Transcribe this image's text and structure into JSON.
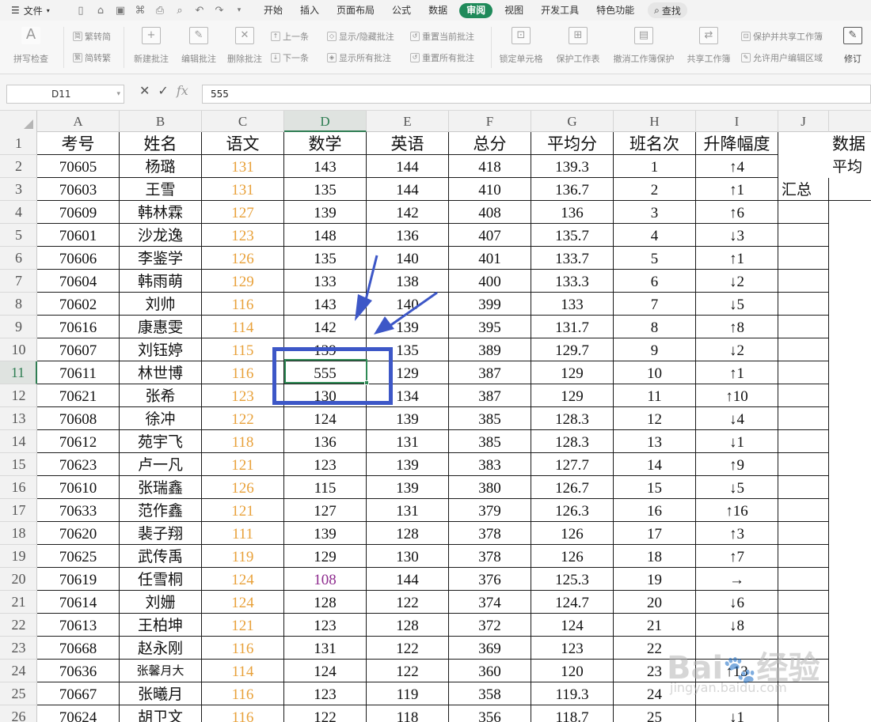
{
  "menubar": {
    "file_label": "文件",
    "tabs": [
      "开始",
      "插入",
      "页面布局",
      "公式",
      "数据",
      "审阅",
      "视图",
      "开发工具",
      "特色功能"
    ],
    "active_tab": "审阅",
    "search_label": "查找"
  },
  "ribbon": {
    "spell_check": "拼写检查",
    "trad_to_simp": "繁转简",
    "simp_to_trad": "简转繁",
    "new_comment": "新建批注",
    "edit_comment": "编辑批注",
    "delete_comment": "删除批注",
    "prev_item": "上一条",
    "next_item": "下一条",
    "show_hide_comment": "显示/隐藏批注",
    "show_all_comments": "显示所有批注",
    "reset_current_comment": "重置当前批注",
    "reset_all_comments": "重置所有批注",
    "lock_cell": "锁定单元格",
    "protect_sheet": "保护工作表",
    "unprotect_workbook": "撤消工作簿保护",
    "share_workbook": "共享工作簿",
    "protect_share_workbook": "保护并共享工作簿",
    "allow_edit_ranges": "允许用户编辑区域",
    "track_changes": "修订"
  },
  "formula_bar": {
    "name_box": "D11",
    "formula": "555"
  },
  "sheet": {
    "column_headers": [
      "A",
      "B",
      "C",
      "D",
      "E",
      "F",
      "G",
      "H",
      "I",
      "J"
    ],
    "selected_column": "D",
    "selected_row": 11,
    "row_numbers": [
      1,
      2,
      3,
      4,
      5,
      6,
      7,
      8,
      9,
      10,
      11,
      12,
      13,
      14,
      15,
      16,
      17,
      18,
      19,
      20,
      21,
      22,
      23,
      24,
      25,
      26
    ],
    "header_row": [
      "考号",
      "姓名",
      "语文",
      "数学",
      "英语",
      "总分",
      "平均分",
      "班名次",
      "升降幅度"
    ],
    "rows": [
      [
        "70605",
        "杨璐",
        "131",
        "143",
        "144",
        "418",
        "139.3",
        "1",
        "↑4"
      ],
      [
        "70603",
        "王雪",
        "131",
        "135",
        "144",
        "410",
        "136.7",
        "2",
        "↑1"
      ],
      [
        "70609",
        "韩林霖",
        "127",
        "139",
        "142",
        "408",
        "136",
        "3",
        "↑6"
      ],
      [
        "70601",
        "沙龙逸",
        "123",
        "148",
        "136",
        "407",
        "135.7",
        "4",
        "↓3"
      ],
      [
        "70606",
        "李鉴学",
        "126",
        "135",
        "140",
        "401",
        "133.7",
        "5",
        "↑1"
      ],
      [
        "70604",
        "韩雨萌",
        "129",
        "133",
        "138",
        "400",
        "133.3",
        "6",
        "↓2"
      ],
      [
        "70602",
        "刘帅",
        "116",
        "143",
        "140",
        "399",
        "133",
        "7",
        "↓5"
      ],
      [
        "70616",
        "康惠雯",
        "114",
        "142",
        "139",
        "395",
        "131.7",
        "8",
        "↑8"
      ],
      [
        "70607",
        "刘钰婷",
        "115",
        "139",
        "135",
        "389",
        "129.7",
        "9",
        "↓2"
      ],
      [
        "70611",
        "林世博",
        "116",
        "555",
        "129",
        "387",
        "129",
        "10",
        "↑1"
      ],
      [
        "70621",
        "张希",
        "123",
        "130",
        "134",
        "387",
        "129",
        "11",
        "↑10"
      ],
      [
        "70608",
        "徐冲",
        "122",
        "124",
        "139",
        "385",
        "128.3",
        "12",
        "↓4"
      ],
      [
        "70612",
        "苑宇飞",
        "118",
        "136",
        "131",
        "385",
        "128.3",
        "13",
        "↓1"
      ],
      [
        "70623",
        "卢一凡",
        "121",
        "123",
        "139",
        "383",
        "127.7",
        "14",
        "↑9"
      ],
      [
        "70610",
        "张瑞鑫",
        "126",
        "115",
        "139",
        "380",
        "126.7",
        "15",
        "↓5"
      ],
      [
        "70633",
        "范作鑫",
        "121",
        "127",
        "131",
        "379",
        "126.3",
        "16",
        "↑16"
      ],
      [
        "70620",
        "裴子翔",
        "111",
        "139",
        "128",
        "378",
        "126",
        "17",
        "↑3"
      ],
      [
        "70625",
        "武传禹",
        "119",
        "129",
        "130",
        "378",
        "126",
        "18",
        "↑7"
      ],
      [
        "70619",
        "任雪桐",
        "124",
        "108",
        "144",
        "376",
        "125.3",
        "19",
        "→"
      ],
      [
        "70614",
        "刘姗",
        "124",
        "128",
        "122",
        "374",
        "124.7",
        "20",
        "↓6"
      ],
      [
        "70613",
        "王柏坤",
        "121",
        "123",
        "128",
        "372",
        "124",
        "21",
        "↓8"
      ],
      [
        "70668",
        "赵永刚",
        "116",
        "131",
        "122",
        "369",
        "123",
        "22",
        ""
      ],
      [
        "70636",
        "张馨月大",
        "114",
        "124",
        "122",
        "360",
        "120",
        "23",
        "↑13"
      ],
      [
        "70667",
        "张曦月",
        "116",
        "123",
        "119",
        "358",
        "119.3",
        "24",
        ""
      ],
      [
        "70624",
        "胡卫文",
        "116",
        "122",
        "118",
        "356",
        "118.7",
        "25",
        "↓1"
      ]
    ],
    "side_labels": {
      "k1": "数据",
      "k2": "平均",
      "j3": "汇总"
    }
  },
  "watermark": {
    "logo_text": "Bai",
    "logo_text2": "经验",
    "url": "jingyan.baidu.com"
  },
  "colors": {
    "active_tab": "#1f8a5a",
    "selection": "#2e8a55",
    "annotation_box": "#3d57c7",
    "chinese_score": "#e8a13a",
    "low_score": "#8e2b8e"
  }
}
